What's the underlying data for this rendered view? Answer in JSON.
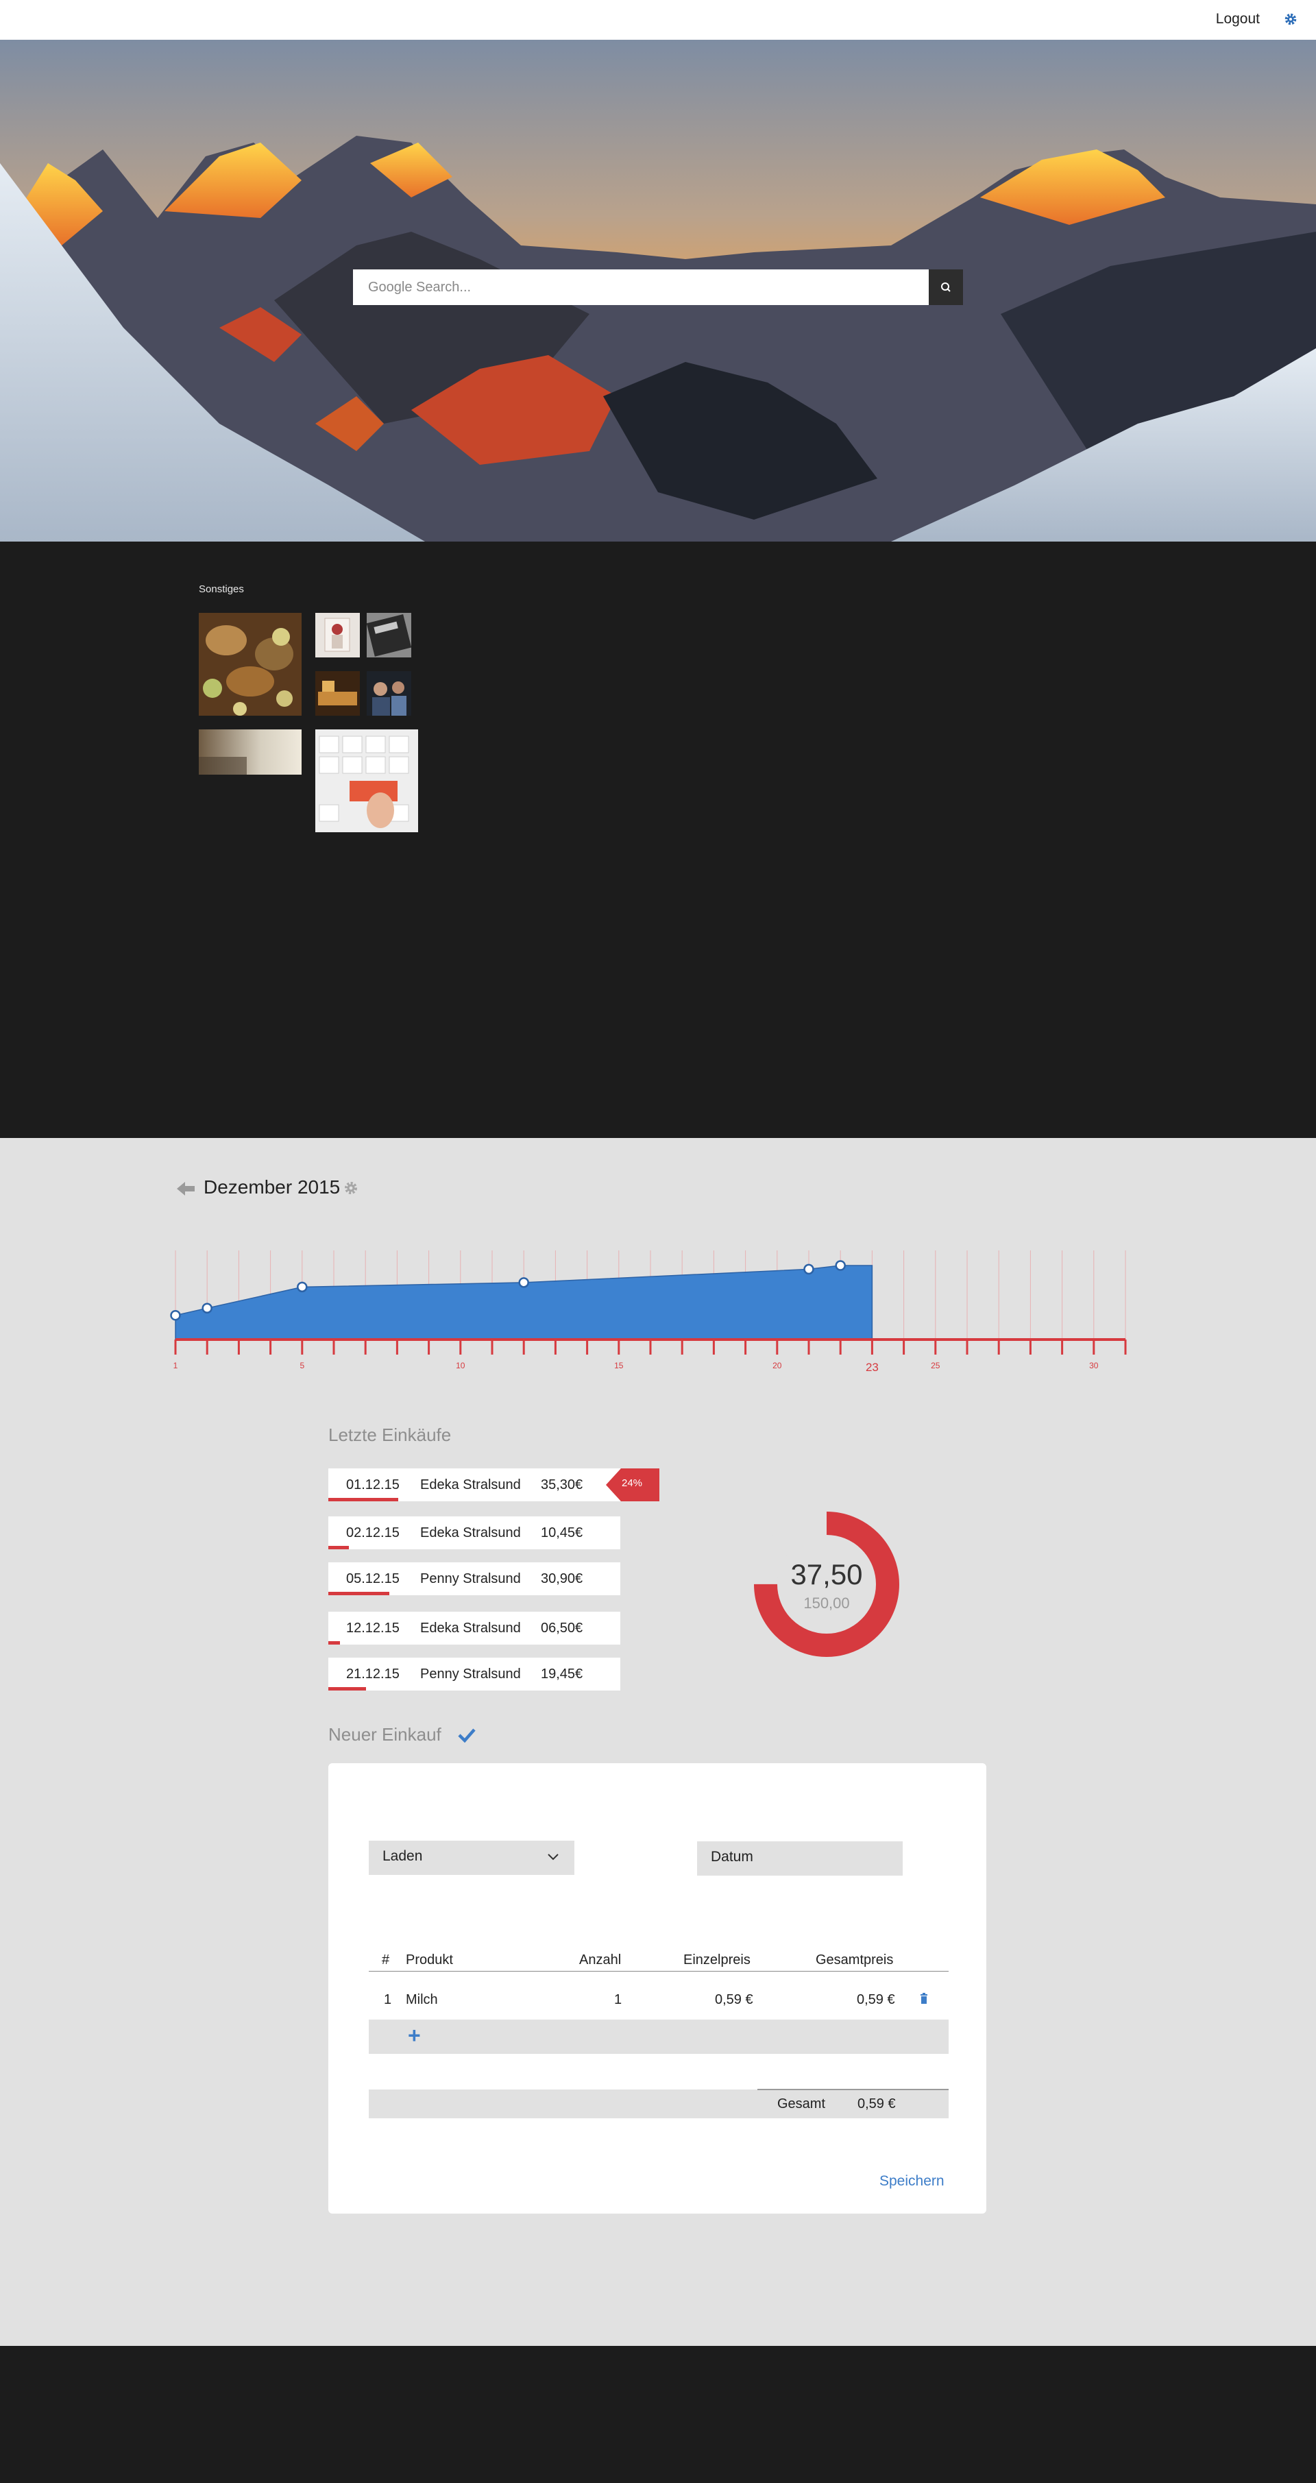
{
  "topbar": {
    "logout_label": "Logout",
    "settings_icon": "gear-icon"
  },
  "search": {
    "placeholder": "Google Search...",
    "icon": "search-icon"
  },
  "category": {
    "title": "Sonstiges"
  },
  "month": {
    "title": "Dezember 2015"
  },
  "timeline": {
    "ticks": [
      "1",
      "5",
      "10",
      "15",
      "20",
      "23",
      "25",
      "30"
    ],
    "current_day": 23
  },
  "chart_data": {
    "type": "area",
    "x": [
      1,
      2,
      5,
      12,
      21,
      22,
      23
    ],
    "y": [
      35.3,
      45.75,
      76.65,
      83.15,
      102.6,
      108,
      108
    ],
    "xlim": [
      1,
      31
    ],
    "ylim": [
      0,
      150
    ],
    "colors": {
      "fill": "#3d82d0",
      "axis": "#d63a3f"
    }
  },
  "purchases": {
    "title": "Letzte Einkäufe",
    "items": [
      {
        "date": "01.12.15",
        "store": "Edeka Stralsund",
        "price": "35,30€",
        "share": 0.24
      },
      {
        "date": "02.12.15",
        "store": "Edeka Stralsund",
        "price": "10,45€",
        "share": 0.07
      },
      {
        "date": "05.12.15",
        "store": "Penny Stralsund",
        "price": "30,90€",
        "share": 0.21
      },
      {
        "date": "12.12.15",
        "store": "Edeka Stralsund",
        "price": "06,50€",
        "share": 0.04
      },
      {
        "date": "21.12.15",
        "store": "Penny Stralsund",
        "price": "19,45€",
        "share": 0.13
      }
    ],
    "badge": "24%"
  },
  "budget": {
    "spent": "37,50",
    "total": "150,00",
    "fraction": 0.75,
    "color": "#d63a3f"
  },
  "new_purchase": {
    "title": "Neuer Einkauf",
    "store_select": "Laden",
    "date_field": "Datum",
    "columns": [
      "#",
      "Produkt",
      "Anzahl",
      "Einzelpreis",
      "Gesamtpreis"
    ],
    "rows": [
      {
        "num": "1",
        "product": "Milch",
        "qty": "1",
        "unit": "0,59 €",
        "total": "0,59 €"
      }
    ],
    "total_label": "Gesamt",
    "total_value": "0,59 €",
    "save_label": "Speichern"
  }
}
